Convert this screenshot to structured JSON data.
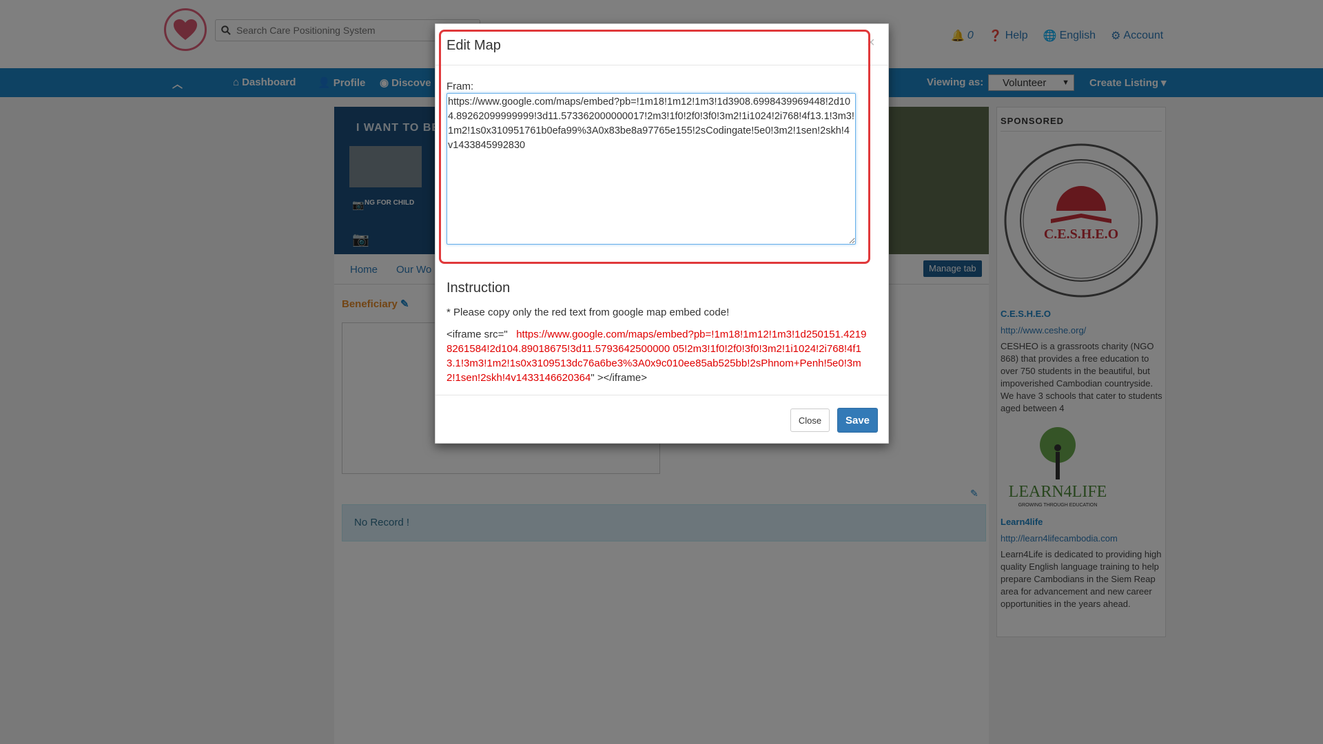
{
  "header": {
    "search_placeholder": "Search Care Positioning System",
    "notifications_count": "0",
    "help": "Help",
    "language": "English",
    "account": "Account"
  },
  "nav": {
    "dashboard": "Dashboard",
    "profile": "Profile",
    "discover": "Discove",
    "viewing_as_label": "Viewing as:",
    "viewing_as_value": "Volunteer",
    "create_listing": "Create Listing"
  },
  "banner": {
    "heading": "I WANT TO BE",
    "thumb_caption": "NG FOR CHILD"
  },
  "tabs": {
    "home": "Home",
    "our_work": "Our Wo",
    "manage_tab": "Manage tab"
  },
  "main": {
    "beneficiary": "Beneficiary",
    "no_record": "No Record !"
  },
  "sidebar": {
    "title": "SPONSORED",
    "seal_text": "C.E.S.H.E.O",
    "sponsor1_name": "C.E.S.H.E.O",
    "sponsor1_url": "http://www.ceshe.org/",
    "sponsor1_desc": "CESHEO is a grassroots charity (NGO 868) that provides a free education to over 750 students in the beautiful, but impoverished Cambodian countryside. We have 3 schools that cater to students aged between 4",
    "logo2_text": "LEARN4LIFE",
    "logo2_tagline": "GROWING THROUGH EDUCATION",
    "sponsor2_name": "Learn4life",
    "sponsor2_url": "http://learn4lifecambodia.com",
    "sponsor2_desc": "Learn4Life is dedicated to providing high quality English language training to help prepare Cambodians in the Siem Reap area for advancement and new career opportunities in the years ahead."
  },
  "modal": {
    "title": "Edit Map",
    "close_x": "×",
    "fram_label": "Fram:",
    "fram_value": "https://www.google.com/maps/embed?pb=!1m18!1m12!1m3!1d3908.6998439969448!2d104.89262099999999!3d11.573362000000017!2m3!1f0!2f0!3f0!3m2!1i1024!2i768!4f13.1!3m3!1m2!1s0x310951761b0efa99%3A0x83be8a97765e155!2sCodingate!5e0!3m2!1sen!2skh!4v1433845992830",
    "instruction_title": "Instruction",
    "instruction_note": "* Please copy only the red text from google map embed code!",
    "iframe_prefix": "<iframe src=\"",
    "iframe_red": "https://www.google.com/maps/embed?pb=!1m18!1m12!1m3!1d250151.42198261584!2d104.89018675!3d11.5793642500000 05!2m3!1f0!2f0!3f0!3m2!1i1024!2i768!4f13.1!3m3!1m2!1s0x3109513dc76a6be3%3A0x9c010ee85ab525bb!2sPhnom+Penh!5e0!3m2!1sen!2skh!4v1433146620364",
    "iframe_suffix": "\" ></iframe>",
    "close_button": "Close",
    "save_button": "Save"
  },
  "colors": {
    "brand_blue": "#1d84c6",
    "highlight_red": "#e0393b",
    "instruction_red": "#e00000",
    "save_blue": "#337ab7"
  }
}
